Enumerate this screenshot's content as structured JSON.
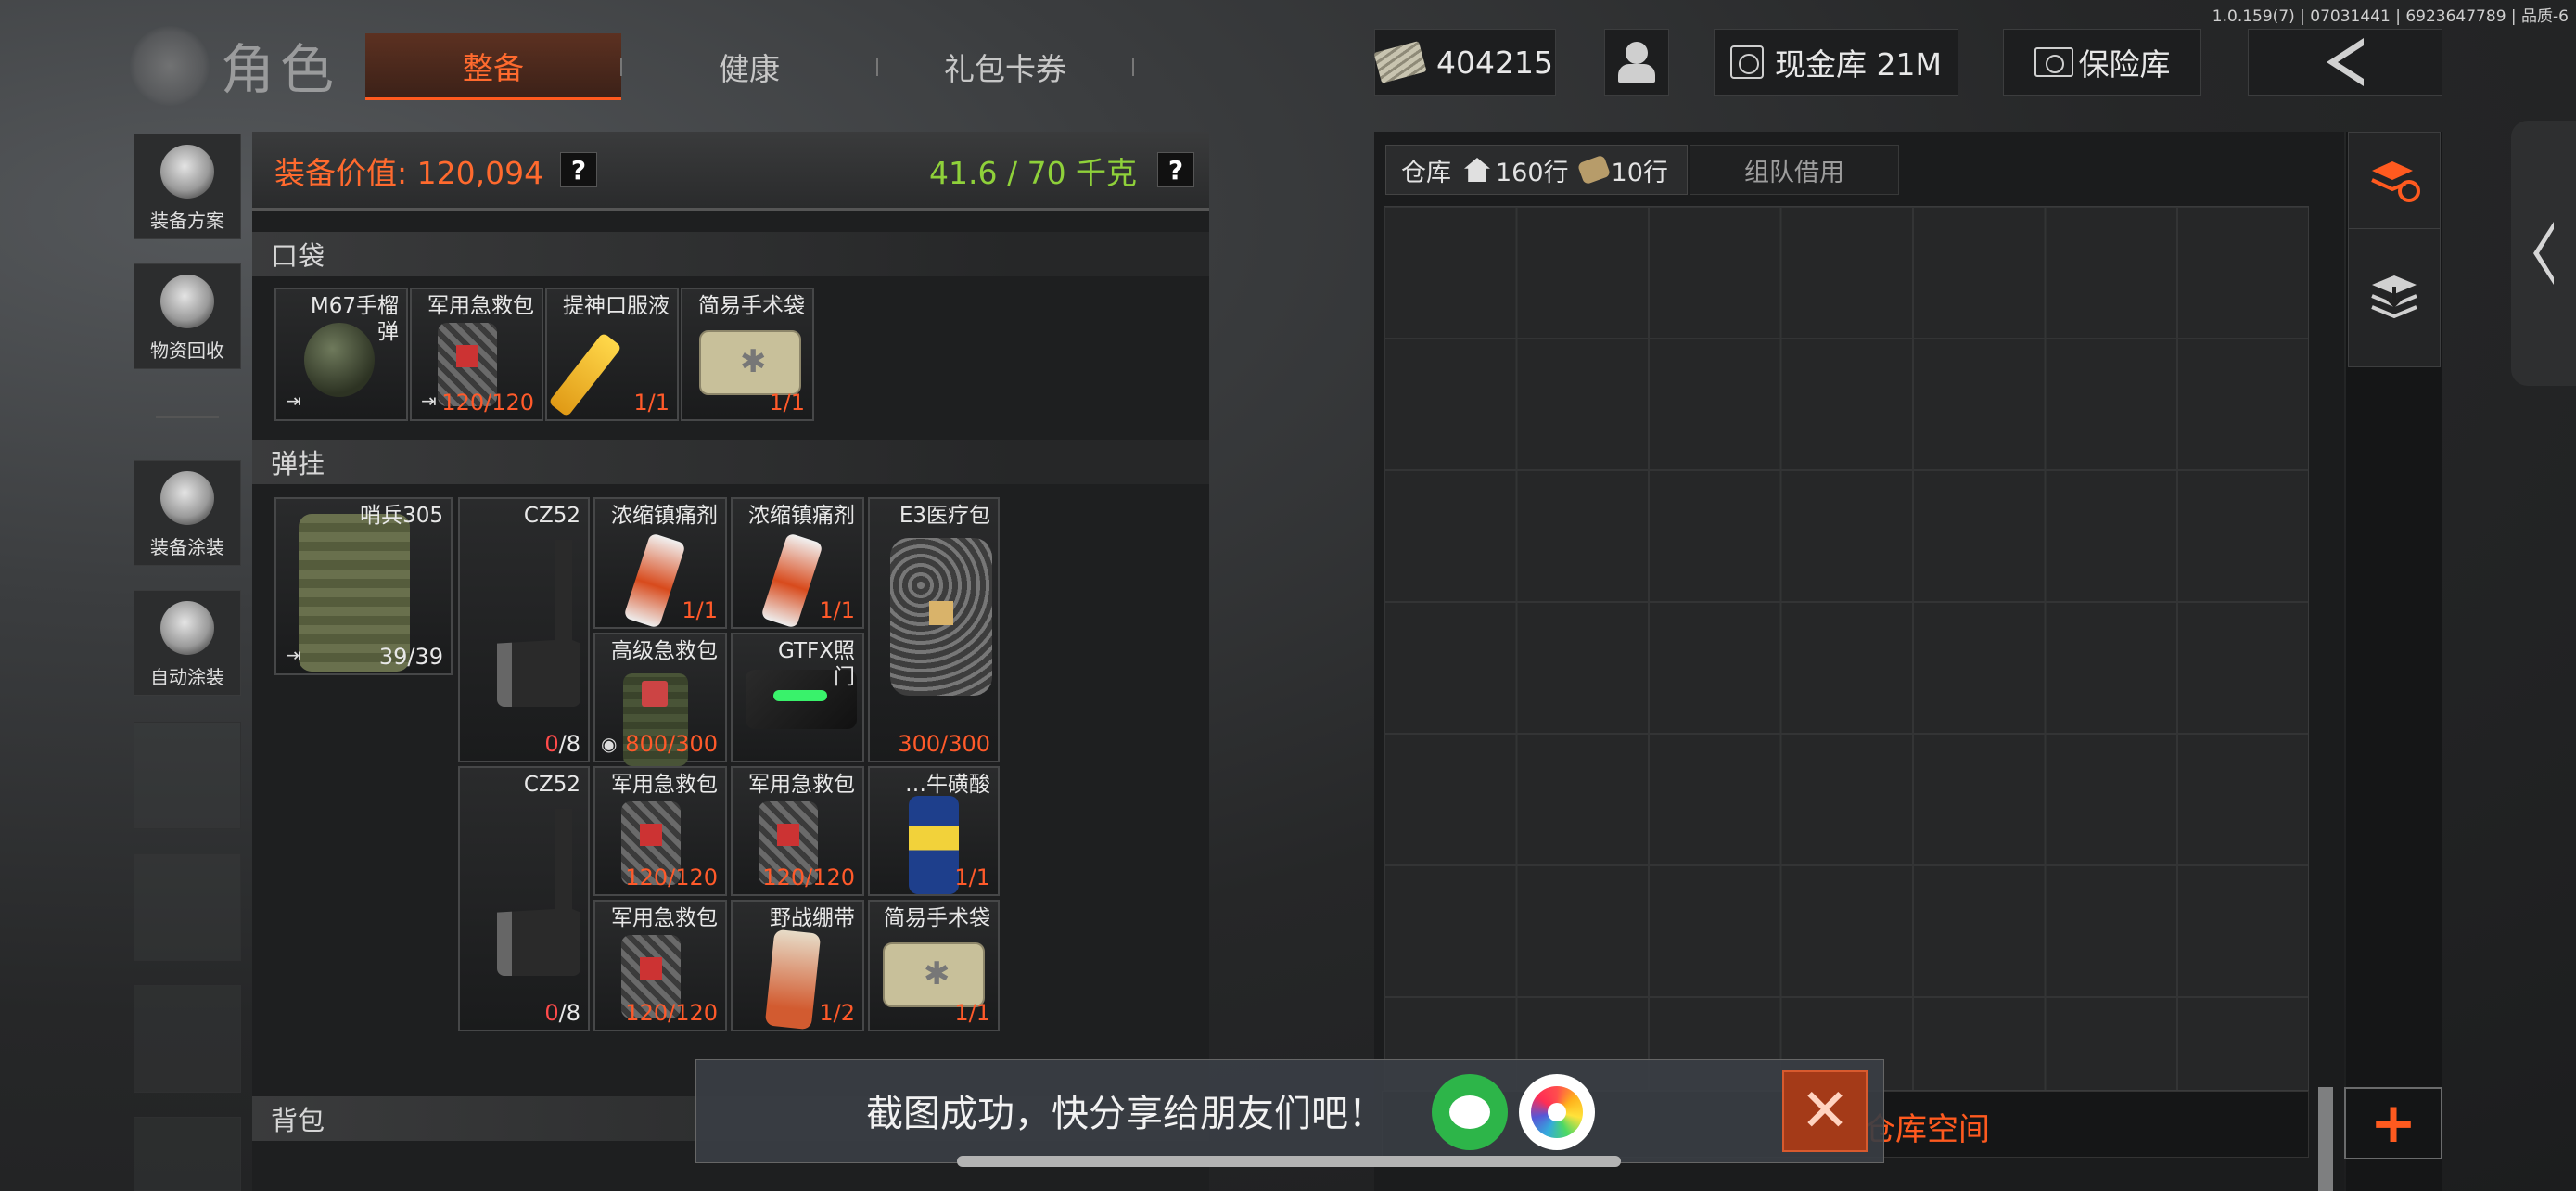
{
  "status_bar": {
    "version": "1.0.159(7) | 07031441 | 6923647789 | 品质-6"
  },
  "header": {
    "title": "角色",
    "tabs": [
      {
        "label": "整备",
        "active": true
      },
      {
        "label": "健康"
      },
      {
        "label": "礼包卡券"
      }
    ],
    "cash": "404215",
    "cash_vault": "现金库 21M",
    "safe": "保险库"
  },
  "sidebar": {
    "items": [
      {
        "label": "装备方案",
        "icon": "helmet-icon"
      },
      {
        "label": "物资回收",
        "icon": "recycle-icon"
      },
      {
        "label": "装备涂装",
        "icon": "helmet-paint-icon"
      },
      {
        "label": "自动涂装",
        "icon": "brush-icon"
      }
    ]
  },
  "gear": {
    "value_label": "装备价值: 120,094",
    "weight_label": "41.6 / 70 千克",
    "help": "?",
    "pocket_title": "口袋",
    "rig_title": "弹挂",
    "backpack_title": "背包",
    "pocket": [
      {
        "name": "M67手榴弹",
        "count": ""
      },
      {
        "name": "军用急救包",
        "count": "120/120"
      },
      {
        "name": "提神口服液",
        "count": "1/1"
      },
      {
        "name": "简易手术袋",
        "count": "1/1"
      }
    ],
    "rig": {
      "vest": {
        "name": "哨兵305",
        "count": "39/39"
      },
      "pistol1": {
        "name": "CZ52",
        "count_zero": "0",
        "count_rest": "/8"
      },
      "pistol2": {
        "name": "CZ52",
        "count_zero": "0",
        "count_rest": "/8"
      },
      "spray1": {
        "name": "浓缩镇痛剂",
        "count": "1/1"
      },
      "spray2": {
        "name": "浓缩镇痛剂",
        "count": "1/1"
      },
      "e3": {
        "name": "E3医疗包",
        "count": "300/300"
      },
      "adv": {
        "name": "高级急救包",
        "count": "800/300"
      },
      "gtfx": {
        "name": "GTFX照门",
        "count": ""
      },
      "kit1": {
        "name": "军用急救包",
        "count": "120/120"
      },
      "kit2": {
        "name": "军用急救包",
        "count": "120/120"
      },
      "can": {
        "name": "…牛磺酸",
        "count": "1/1"
      },
      "kit3": {
        "name": "军用急救包",
        "count": "120/120"
      },
      "bandage": {
        "name": "野战绷带",
        "count": "1/2"
      },
      "pouch": {
        "name": "简易手术袋",
        "count": "1/1"
      }
    }
  },
  "warehouse": {
    "tab_label": "仓库",
    "rows_home": "160行",
    "rows_extra": "10行",
    "team_tab": "组队借用",
    "expand_label": "仓库空间"
  },
  "toast": {
    "message": "截图成功，快分享给朋友们吧！"
  },
  "colors": {
    "accent": "#ff5a1f",
    "weight_green": "#8fd13a",
    "wechat": "#2db549"
  }
}
